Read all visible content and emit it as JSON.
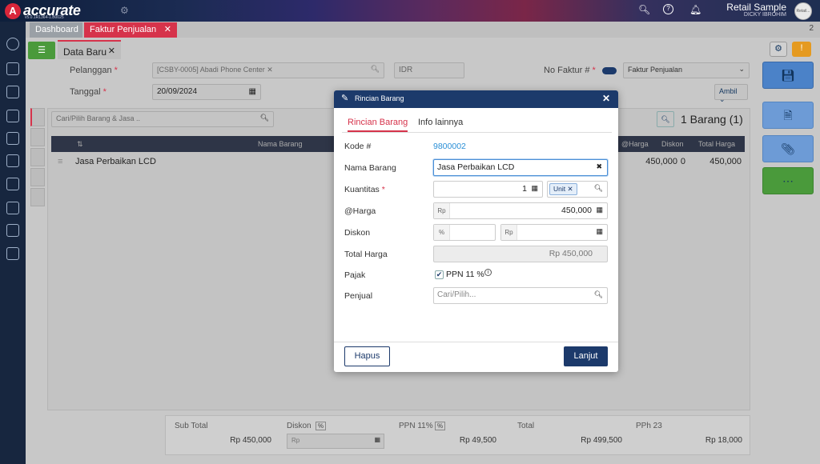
{
  "app": {
    "logo_text": "accurate",
    "version_text": "v5.0.1R1364-1.B0025",
    "company": "Retail Sample",
    "user": "DICKY IBROHIM",
    "avatar_text": "Retail..."
  },
  "tabs": {
    "dashboard": "Dashboard",
    "faktur": "Faktur Penjualan",
    "count": "2"
  },
  "subtab": {
    "label": "Data Baru"
  },
  "form": {
    "pelanggan_label": "Pelanggan",
    "pelanggan_value": "[CSBY-0005] Abadi Phone Center",
    "currency": "IDR",
    "no_faktur_label": "No Faktur #",
    "faktur_type": "Faktur Penjualan",
    "tanggal_label": "Tanggal",
    "tanggal_value": "20/09/2024",
    "ambil": "Ambil",
    "required_mark": "*"
  },
  "items": {
    "search_placeholder": "Cari/Pilih Barang & Jasa ..",
    "count_label": "1 Barang (1)",
    "headers": {
      "no": "⇅",
      "nama": "Nama Barang",
      "harga": "@Harga",
      "diskon": "Diskon",
      "total": "Total Harga"
    },
    "rows": [
      {
        "nama": "Jasa Perbaikan LCD",
        "harga": "450,000",
        "diskon": "0",
        "total": "450,000"
      }
    ]
  },
  "summary": {
    "sub_total_label": "Sub Total",
    "sub_total": "Rp 450,000",
    "diskon_label": "Diskon",
    "diskon_badge": "%",
    "diskon_prefix": "Rp",
    "ppn_label": "PPN 11%",
    "ppn_badge": "%",
    "ppn": "Rp 49,500",
    "total_label": "Total",
    "total": "Rp 499,500",
    "pph_label": "PPh 23",
    "pph": "Rp 18,000"
  },
  "modal": {
    "title": "Rincian Barang",
    "tab_active": "Rincian Barang",
    "tab_other": "Info lainnya",
    "kode_label": "Kode #",
    "kode_value": "9800002",
    "nama_label": "Nama Barang",
    "nama_value": "Jasa Perbaikan LCD",
    "kuantitas_label": "Kuantitas",
    "kuantitas_value": "1",
    "unit": "Unit",
    "harga_label": "@Harga",
    "harga_prefix": "Rp",
    "harga_value": "450,000",
    "diskon_label": "Diskon",
    "diskon_pct_prefix": "%",
    "diskon_rp_prefix": "Rp",
    "total_label": "Total Harga",
    "total_value": "Rp 450,000",
    "pajak_label": "Pajak",
    "ppn_checkbox": "PPN 11 %",
    "penjual_label": "Penjual",
    "penjual_placeholder": "Cari/Pilih...",
    "hapus": "Hapus",
    "lanjut": "Lanjut"
  },
  "colors": {
    "brand": "#d6334b",
    "navy": "#1c3a6b",
    "green": "#4a9a3b",
    "orange": "#e59a20"
  }
}
